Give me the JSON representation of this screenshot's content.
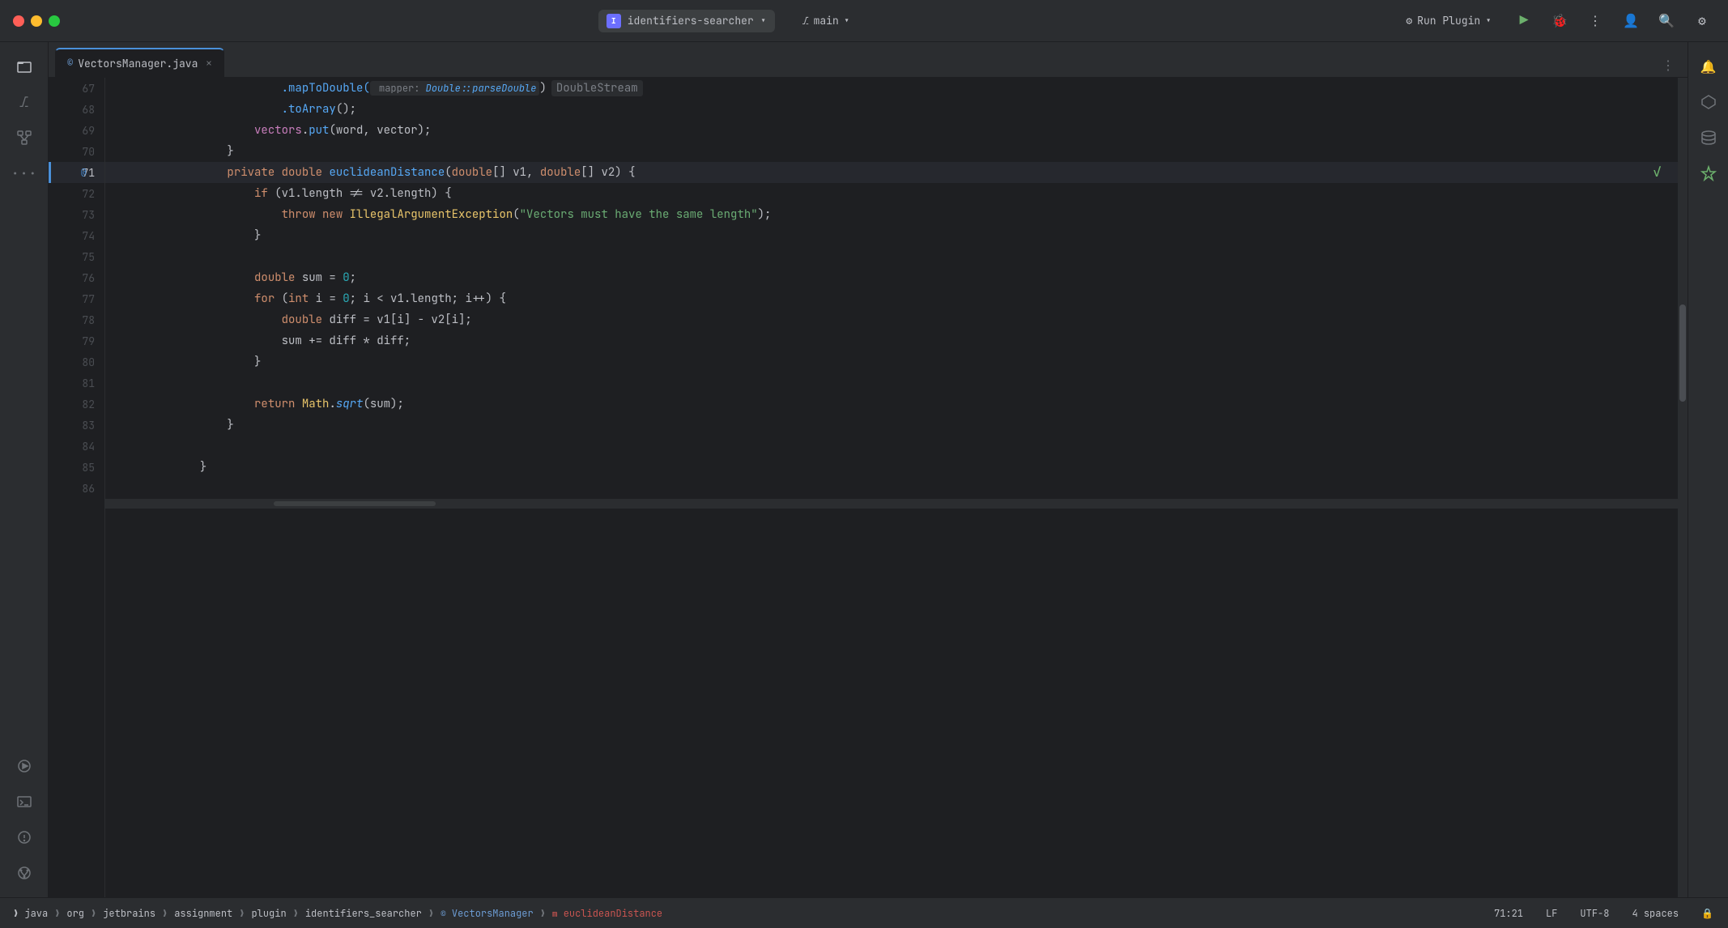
{
  "titleBar": {
    "trafficLights": [
      "red",
      "yellow",
      "green"
    ],
    "projectName": "identifiers-searcher",
    "projectIcon": "I",
    "branchName": "main",
    "runPluginLabel": "Run Plugin",
    "moreOptionsLabel": "⋮"
  },
  "tabs": [
    {
      "id": "vectors-manager",
      "label": "VectorsManager.java",
      "icon": "©",
      "active": true,
      "closable": true
    }
  ],
  "editor": {
    "lines": [
      {
        "num": 67,
        "indent": 3,
        "content": ".mapToDouble(",
        "hint": "mapper: Double::parseDouble",
        "hintType": " DoubleStream",
        "hasHint": true
      },
      {
        "num": 68,
        "indent": 3,
        "content": ".toArray();",
        "hasHint": false
      },
      {
        "num": 69,
        "indent": 2,
        "content": "vectors.put(word, vector);",
        "hasHint": false
      },
      {
        "num": 70,
        "indent": 1,
        "content": "}",
        "hasHint": false
      },
      {
        "num": 71,
        "indent": 1,
        "active": true,
        "method_marker": "@",
        "content_parts": [
          {
            "type": "kw",
            "text": "private "
          },
          {
            "type": "kw",
            "text": "double "
          },
          {
            "type": "fn",
            "text": "euclideanDistance"
          },
          {
            "type": "op",
            "text": "("
          },
          {
            "type": "kw",
            "text": "double"
          },
          {
            "type": "op",
            "text": "[] v1, "
          },
          {
            "type": "kw",
            "text": "double"
          },
          {
            "type": "op",
            "text": "[] v2) {"
          }
        ]
      },
      {
        "num": 72,
        "indent": 2,
        "content": "if (v1.length != v2.length) {",
        "hasHint": false
      },
      {
        "num": 73,
        "indent": 3,
        "content_str": "throw new IllegalArgumentException(\"Vectors must have the same length\");",
        "hasHint": false
      },
      {
        "num": 74,
        "indent": 2,
        "content": "}",
        "hasHint": false
      },
      {
        "num": 75,
        "indent": 0,
        "content": "",
        "hasHint": false
      },
      {
        "num": 76,
        "indent": 2,
        "content_parts": [
          {
            "type": "kw",
            "text": "double "
          },
          {
            "type": "var",
            "text": "sum = "
          },
          {
            "type": "num",
            "text": "0"
          },
          {
            "type": "op",
            "text": ";"
          }
        ]
      },
      {
        "num": 77,
        "indent": 2,
        "content_parts": [
          {
            "type": "kw",
            "text": "for "
          },
          {
            "type": "op",
            "text": "("
          },
          {
            "type": "kw",
            "text": "int "
          },
          {
            "type": "var",
            "text": "i = "
          },
          {
            "type": "num",
            "text": "0"
          },
          {
            "type": "op",
            "text": "; i < v1.length; i++) {"
          }
        ]
      },
      {
        "num": 78,
        "indent": 3,
        "content_parts": [
          {
            "type": "kw",
            "text": "double "
          },
          {
            "type": "var",
            "text": "diff = v1[i] - v2[i];"
          }
        ]
      },
      {
        "num": 79,
        "indent": 3,
        "content": "sum += diff * diff;",
        "hasHint": false
      },
      {
        "num": 80,
        "indent": 2,
        "content": "}",
        "hasHint": false
      },
      {
        "num": 81,
        "indent": 0,
        "content": "",
        "hasHint": false
      },
      {
        "num": 82,
        "indent": 2,
        "content_parts": [
          {
            "type": "kw",
            "text": "return "
          },
          {
            "type": "class-name",
            "text": "Math"
          },
          {
            "type": "op",
            "text": "."
          },
          {
            "type": "method-name",
            "text": "sqrt"
          },
          {
            "type": "op",
            "text": "(sum);"
          }
        ]
      },
      {
        "num": 83,
        "indent": 1,
        "content": "}",
        "hasHint": false
      },
      {
        "num": 84,
        "indent": 0,
        "content": "",
        "hasHint": false
      },
      {
        "num": 85,
        "indent": 0,
        "content": "}",
        "hasHint": false
      },
      {
        "num": 86,
        "indent": 0,
        "content": "",
        "hasHint": false
      }
    ]
  },
  "statusBar": {
    "breadcrumbs": [
      {
        "label": "java",
        "type": "folder"
      },
      {
        "label": "org",
        "type": "folder"
      },
      {
        "label": "jetbrains",
        "type": "folder"
      },
      {
        "label": "assignment",
        "type": "folder"
      },
      {
        "label": "plugin",
        "type": "folder"
      },
      {
        "label": "identifiers_searcher",
        "type": "folder"
      },
      {
        "label": "VectorsManager",
        "type": "class"
      },
      {
        "label": "euclideanDistance",
        "type": "method"
      }
    ],
    "position": "71:21",
    "lineEnding": "LF",
    "encoding": "UTF-8",
    "indentation": "4 spaces"
  },
  "rightPanel": {
    "icons": [
      {
        "name": "notification-icon",
        "symbol": "🔔",
        "active": false
      },
      {
        "name": "diamond-icon",
        "symbol": "◇",
        "active": false
      },
      {
        "name": "database-icon",
        "symbol": "🗄",
        "active": false
      },
      {
        "name": "ai-icon",
        "symbol": "◈",
        "active": false
      }
    ]
  },
  "leftSidebar": {
    "icons": [
      {
        "name": "folder-icon",
        "symbol": "📁"
      },
      {
        "name": "git-icon",
        "symbol": "⎇"
      },
      {
        "name": "structure-icon",
        "symbol": "⊞"
      },
      {
        "name": "more-icon",
        "symbol": "···"
      },
      {
        "name": "run-icon",
        "symbol": "▷"
      },
      {
        "name": "terminal-icon",
        "symbol": "▭"
      },
      {
        "name": "problems-icon",
        "symbol": "⚠"
      },
      {
        "name": "git-history-icon",
        "symbol": "⎋"
      }
    ]
  }
}
